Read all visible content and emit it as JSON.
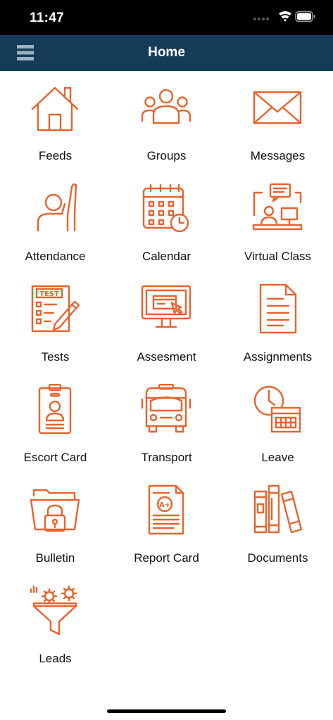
{
  "status_bar": {
    "time": "11:47"
  },
  "header": {
    "title": "Home",
    "menu_icon": "hamburger-menu-icon"
  },
  "theme": {
    "accent": "#e8632c",
    "header_bg": "#143b57"
  },
  "tiles": [
    {
      "label": "Feeds",
      "icon": "house-icon"
    },
    {
      "label": "Groups",
      "icon": "group-people-icon"
    },
    {
      "label": "Messages",
      "icon": "envelope-icon"
    },
    {
      "label": "Attendance",
      "icon": "raised-hand-icon"
    },
    {
      "label": "Calendar",
      "icon": "calendar-clock-icon"
    },
    {
      "label": "Virtual Class",
      "icon": "virtual-class-icon"
    },
    {
      "label": "Tests",
      "icon": "test-paper-icon"
    },
    {
      "label": "Assesment",
      "icon": "monitor-cursor-icon"
    },
    {
      "label": "Assignments",
      "icon": "document-icon"
    },
    {
      "label": "Escort Card",
      "icon": "id-badge-icon"
    },
    {
      "label": "Transport",
      "icon": "bus-icon"
    },
    {
      "label": "Leave",
      "icon": "clock-calendar-icon"
    },
    {
      "label": "Bulletin",
      "icon": "locked-folder-icon"
    },
    {
      "label": "Report Card",
      "icon": "report-card-icon"
    },
    {
      "label": "Documents",
      "icon": "books-icon"
    },
    {
      "label": "Leads",
      "icon": "funnel-gears-icon"
    }
  ]
}
